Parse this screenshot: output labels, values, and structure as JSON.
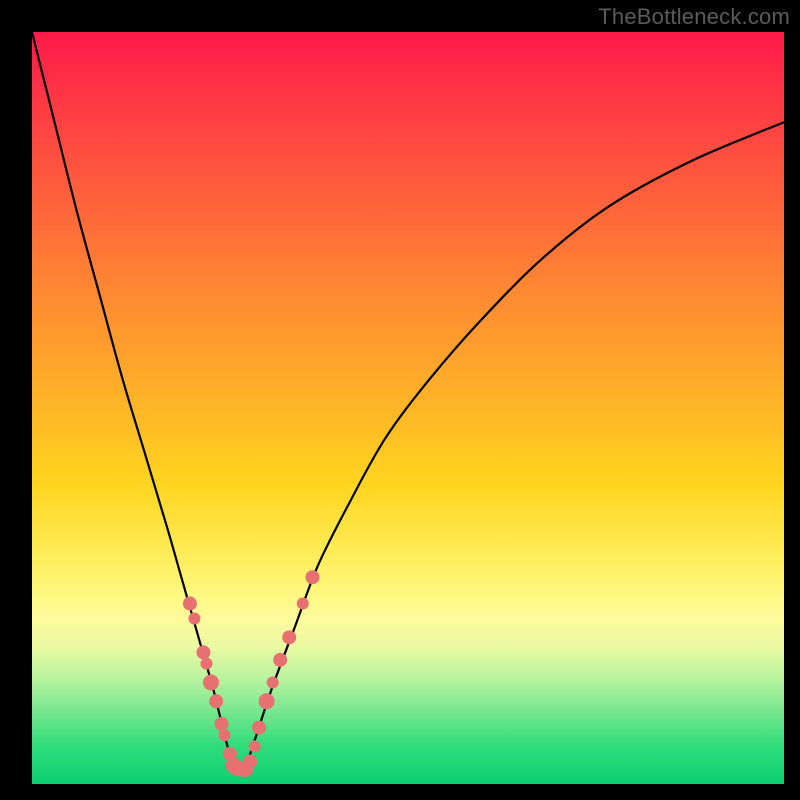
{
  "watermark": "TheBottleneck.com",
  "colors": {
    "frame": "#000000",
    "curve": "#000000",
    "dot": "#e77070",
    "gradient_top": "#ff1a49",
    "gradient_bottom": "#0ccf71"
  },
  "chart_data": {
    "type": "line",
    "title": "",
    "xlabel": "",
    "ylabel": "",
    "xlim": [
      0,
      100
    ],
    "ylim": [
      0,
      100
    ],
    "note": "V-shaped bottleneck curve on rainbow gradient; minimum near x≈27, y≈0. No axis ticks or numeric labels are rendered.",
    "series": [
      {
        "name": "bottleneck-curve",
        "x": [
          0,
          3,
          6,
          9,
          12,
          15,
          18,
          20,
          22,
          24,
          25,
          26,
          27,
          28,
          29,
          30,
          32,
          35,
          38,
          42,
          47,
          53,
          60,
          68,
          77,
          88,
          100
        ],
        "y": [
          100,
          88,
          76,
          65,
          54,
          44,
          34,
          27,
          20,
          13,
          9,
          5,
          2,
          2,
          4,
          7,
          13,
          21,
          29,
          37,
          46,
          54,
          62,
          70,
          77,
          83,
          88
        ]
      }
    ],
    "dots": {
      "name": "highlight-points",
      "points": [
        {
          "x": 21.0,
          "y": 24.0,
          "r": 7
        },
        {
          "x": 21.6,
          "y": 22.0,
          "r": 6
        },
        {
          "x": 22.8,
          "y": 17.5,
          "r": 7
        },
        {
          "x": 23.2,
          "y": 16.0,
          "r": 6
        },
        {
          "x": 23.8,
          "y": 13.5,
          "r": 8
        },
        {
          "x": 24.5,
          "y": 11.0,
          "r": 7
        },
        {
          "x": 25.2,
          "y": 8.0,
          "r": 7
        },
        {
          "x": 25.6,
          "y": 6.5,
          "r": 6
        },
        {
          "x": 26.3,
          "y": 4.0,
          "r": 7
        },
        {
          "x": 26.8,
          "y": 2.5,
          "r": 8
        },
        {
          "x": 27.2,
          "y": 2.0,
          "r": 7
        },
        {
          "x": 27.8,
          "y": 1.8,
          "r": 6
        },
        {
          "x": 28.4,
          "y": 2.0,
          "r": 8
        },
        {
          "x": 29.0,
          "y": 3.0,
          "r": 7
        },
        {
          "x": 29.6,
          "y": 5.0,
          "r": 6
        },
        {
          "x": 30.2,
          "y": 7.5,
          "r": 7
        },
        {
          "x": 31.2,
          "y": 11.0,
          "r": 8
        },
        {
          "x": 32.0,
          "y": 13.5,
          "r": 6
        },
        {
          "x": 33.0,
          "y": 16.5,
          "r": 7
        },
        {
          "x": 34.2,
          "y": 19.5,
          "r": 7
        },
        {
          "x": 36.0,
          "y": 24.0,
          "r": 6
        },
        {
          "x": 37.3,
          "y": 27.5,
          "r": 7
        }
      ]
    }
  }
}
